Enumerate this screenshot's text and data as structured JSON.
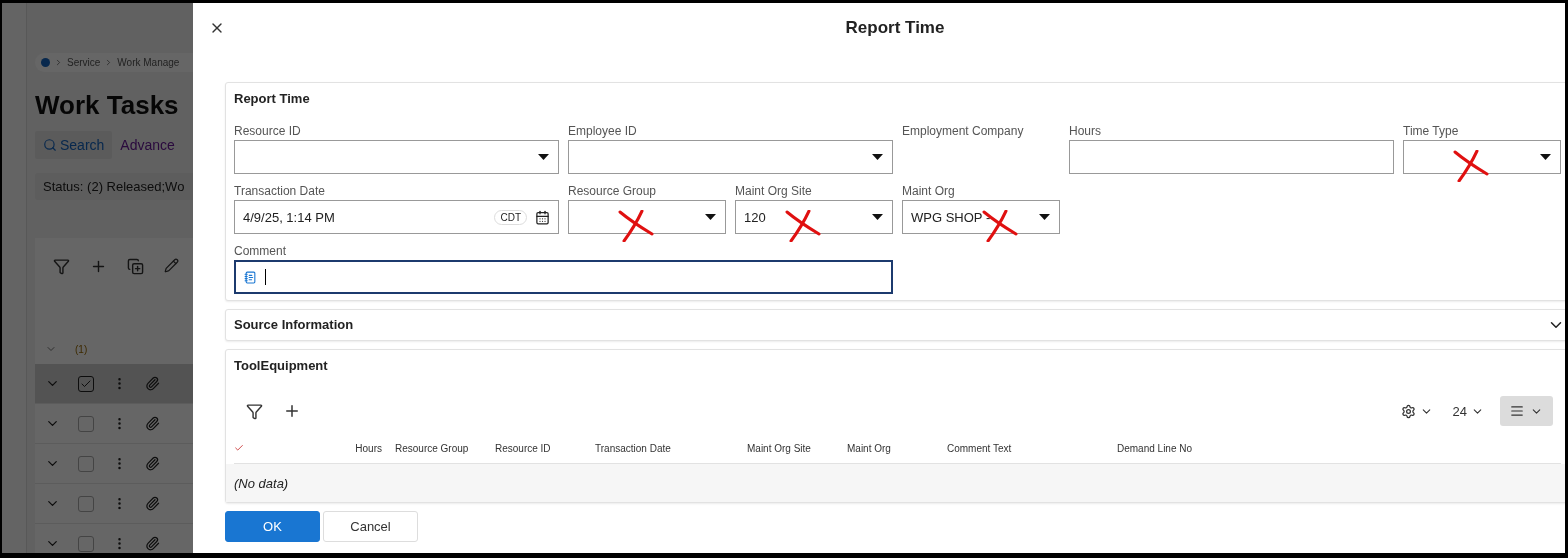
{
  "background_page": {
    "breadcrumb": [
      "Service",
      "Work Manage"
    ],
    "title": "Work Tasks",
    "search_button": "Search",
    "advanced_link": "Advance",
    "status_filter": "Status: (2) Released;Wo",
    "selected_count": "(1)",
    "rows": [
      {
        "selected": true,
        "checked": true
      },
      {
        "selected": false,
        "checked": false
      },
      {
        "selected": false,
        "checked": false
      },
      {
        "selected": false,
        "checked": false
      },
      {
        "selected": false,
        "checked": false
      }
    ]
  },
  "dialog": {
    "title": "Report Time",
    "section_title": "Report Time",
    "fields": [
      {
        "label": "Resource ID",
        "kind": "dropdown"
      },
      {
        "label": "Employee ID",
        "kind": "dropdown"
      },
      {
        "label": "Employment Company",
        "kind": "readonly"
      },
      {
        "label": "Hours",
        "kind": "text"
      },
      {
        "label": "Time Type",
        "kind": "dropdown",
        "crossed_out": true
      },
      {
        "label": "Transaction Date",
        "kind": "date",
        "value": "4/9/25, 1:14 PM",
        "timezone": "CDT"
      },
      {
        "label": "Resource Group",
        "kind": "dropdown",
        "crossed_out": true
      },
      {
        "label": "Maint Org Site",
        "kind": "dropdown",
        "value": "120",
        "crossed_out": true
      },
      {
        "label": "Maint Org",
        "kind": "dropdown",
        "value": "WPG SHOP -",
        "crossed_out": true
      },
      {
        "label": "Comment",
        "kind": "comment",
        "focused": true
      }
    ],
    "source_section": {
      "title": "Source Information",
      "expanded": false
    },
    "tool_equipment": {
      "title": "ToolEquipment",
      "page_size": "24",
      "columns": [
        "Hours",
        "Resource Group",
        "Resource ID",
        "Transaction Date",
        "Maint Org Site",
        "Maint Org",
        "Comment Text",
        "Demand Line No"
      ],
      "empty_text": "(No data)"
    },
    "buttons": [
      {
        "label": "OK",
        "primary": true
      },
      {
        "label": "Cancel",
        "primary": false
      }
    ]
  }
}
